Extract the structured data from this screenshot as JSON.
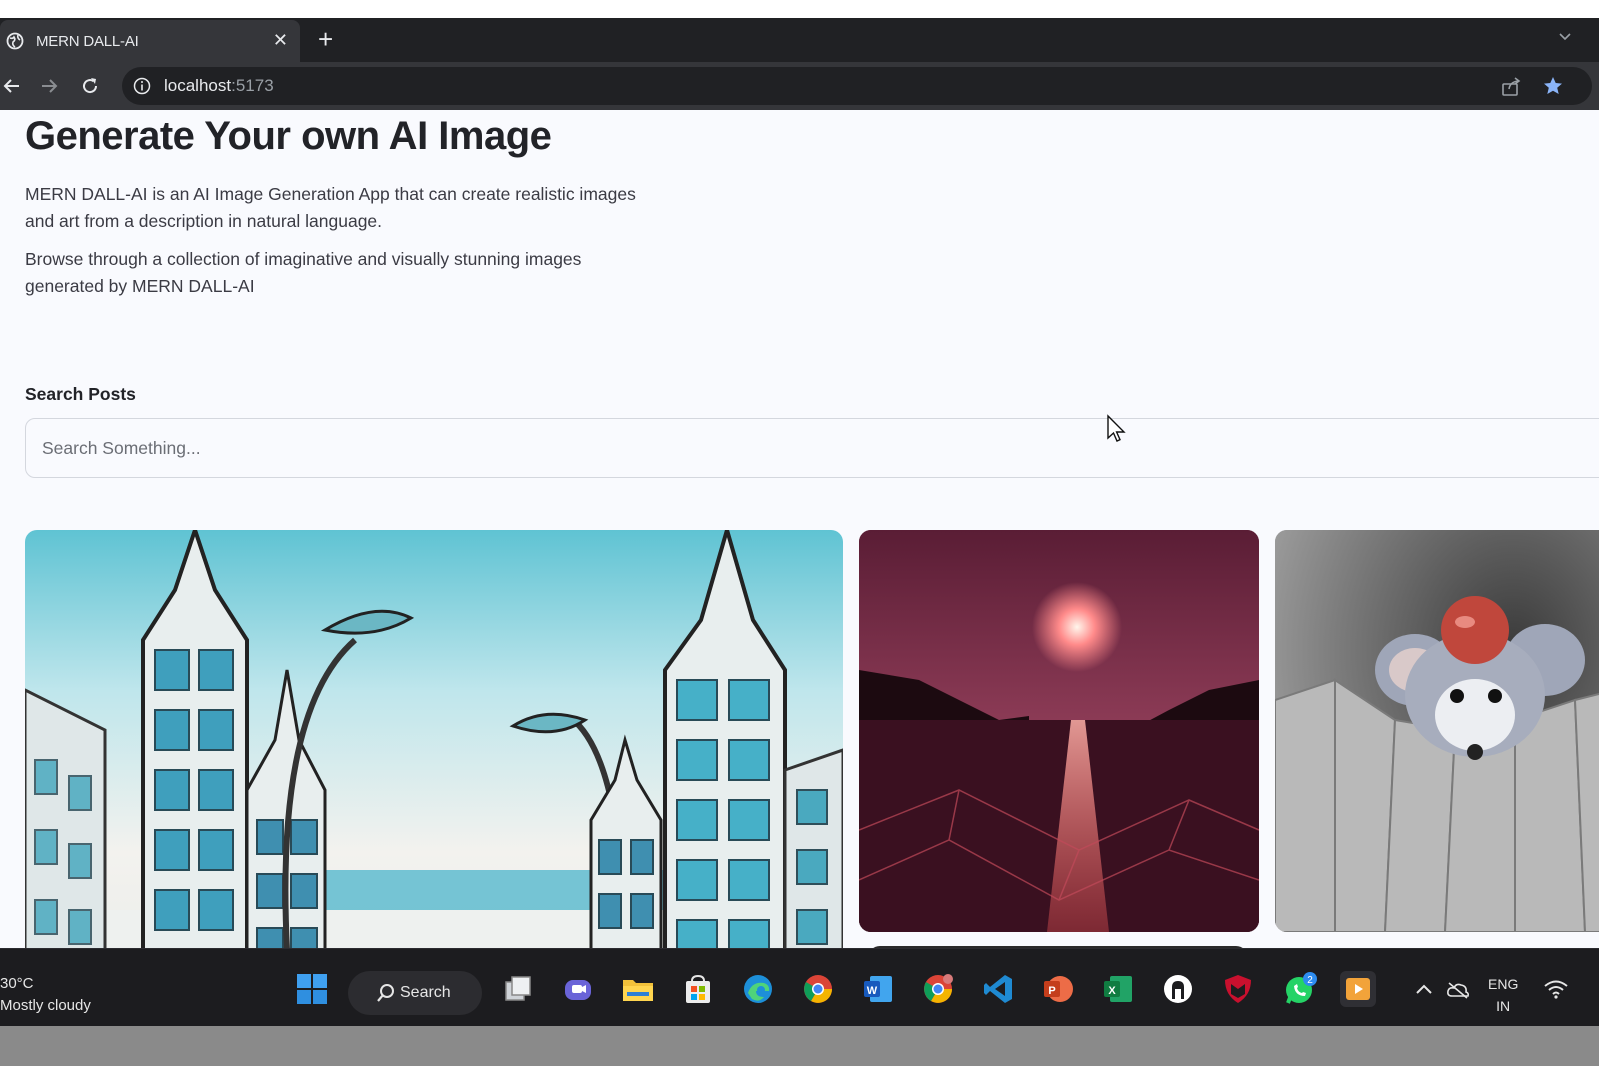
{
  "browser": {
    "tab_title": "MERN DALL-AI",
    "url_host": "localhost",
    "url_port": ":5173"
  },
  "page": {
    "title": "Generate Your own AI Image",
    "description_1": "MERN DALL-AI is an AI Image Generation App that can create realistic images and art from a description in natural language.",
    "description_2": "Browse through a collection of imaginative and visually stunning images generated by MERN DALL-AI",
    "search_label": "Search Posts",
    "search_placeholder": "Search Something..."
  },
  "taskbar": {
    "weather_temp": "30°C",
    "weather_desc": "Mostly cloudy",
    "search_label": "Search",
    "lang_1": "ENG",
    "lang_2": "IN",
    "whatsapp_badge": "2"
  },
  "colors": {
    "page_bg": "#f9fafe",
    "title": "#222328",
    "tab_bg": "#35363a",
    "taskbar_bg": "#1c1c1f"
  }
}
